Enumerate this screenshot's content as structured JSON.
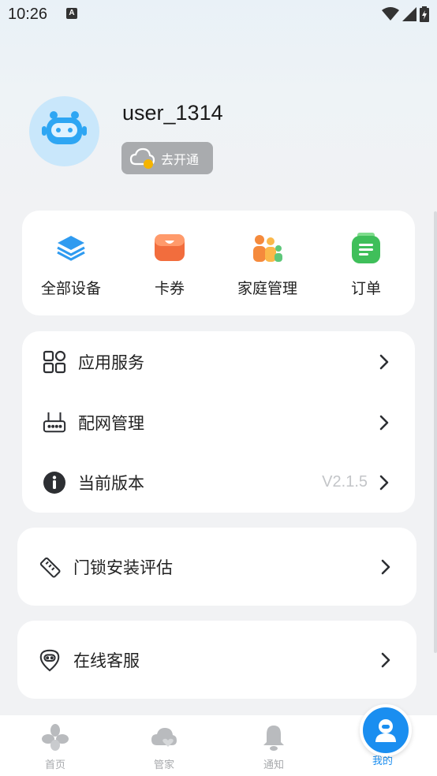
{
  "status_bar": {
    "time": "10:26",
    "notice_glyph": "A"
  },
  "profile": {
    "username": "user_1314",
    "vip_label": "去开通"
  },
  "quick_actions": [
    {
      "label": "全部设备",
      "icon": "layers-icon"
    },
    {
      "label": "卡券",
      "icon": "coupon-icon"
    },
    {
      "label": "家庭管理",
      "icon": "family-icon"
    },
    {
      "label": "订单",
      "icon": "order-icon"
    }
  ],
  "menu": {
    "app_services": "应用服务",
    "network_mgmt": "配网管理",
    "current_version": "当前版本",
    "version_value": "V2.1.5"
  },
  "lock_eval": {
    "label": "门锁安装评估"
  },
  "online_service": {
    "label": "在线客服"
  },
  "tabbar": {
    "home": "首页",
    "butler": "管家",
    "notify": "通知",
    "mine": "我的"
  },
  "colors": {
    "accent": "#1a8ef0",
    "coupon": "#f26d3d",
    "order": "#3fbf5a"
  }
}
